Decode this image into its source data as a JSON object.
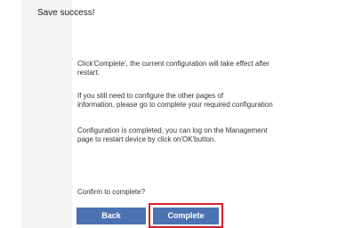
{
  "header": {
    "title": "Save success!"
  },
  "messages": [
    {
      "line1": "Click'Complete', the current configuration will take effect after",
      "line2": "restart."
    },
    {
      "line1": "If you still need to configure the other pages of",
      "line2": "information, please go to complete your required configuration"
    },
    {
      "line1": "Configuration is completed, you can log on the Management",
      "line2": "page to restart device by click on'OK'button."
    }
  ],
  "confirm_prompt": "Confirm to complete?",
  "buttons": {
    "back": "Back",
    "complete": "Complete"
  },
  "colors": {
    "button_bg": "#4d72b4",
    "highlight": "#d21f2d"
  }
}
